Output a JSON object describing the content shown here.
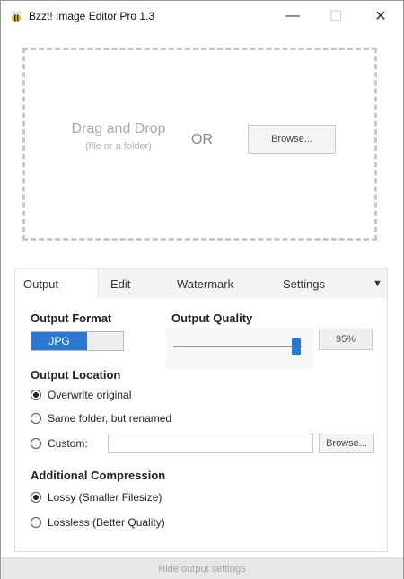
{
  "window": {
    "title": "Bzzt! Image Editor Pro 1.3",
    "minimize_glyph": "—",
    "maximize_glyph": "☐",
    "close_glyph": "✕"
  },
  "dropzone": {
    "title": "Drag and Drop",
    "subtitle": "(file or a folder)",
    "or_label": "OR",
    "browse_label": "Browse..."
  },
  "tabs": [
    {
      "label": "Output",
      "active": true
    },
    {
      "label": "Edit",
      "active": false
    },
    {
      "label": "Watermark",
      "active": false
    },
    {
      "label": "Settings",
      "active": false
    }
  ],
  "tab_menu_glyph": "▼",
  "output": {
    "format_label": "Output Format",
    "format_value": "JPG",
    "quality_label": "Output Quality",
    "quality_value": "95%",
    "quality_fraction": 0.95,
    "location_label": "Output Location",
    "location_options": [
      {
        "label": "Overwrite original",
        "checked": true
      },
      {
        "label": "Same folder, but renamed",
        "checked": false
      },
      {
        "label": "Custom:",
        "checked": false
      }
    ],
    "custom_path_value": "",
    "browse_label": "Browse...",
    "compression_label": "Additional Compression",
    "compression_options": [
      {
        "label": "Lossy (Smaller Filesize)",
        "checked": true
      },
      {
        "label": "Lossless (Better Quality)",
        "checked": false
      }
    ]
  },
  "footer": {
    "label": "Hide output settings"
  },
  "colors": {
    "accent": "#2b78d0"
  },
  "icons": {
    "app": "bee-icon",
    "tab_menu": "chevron-down-icon"
  }
}
